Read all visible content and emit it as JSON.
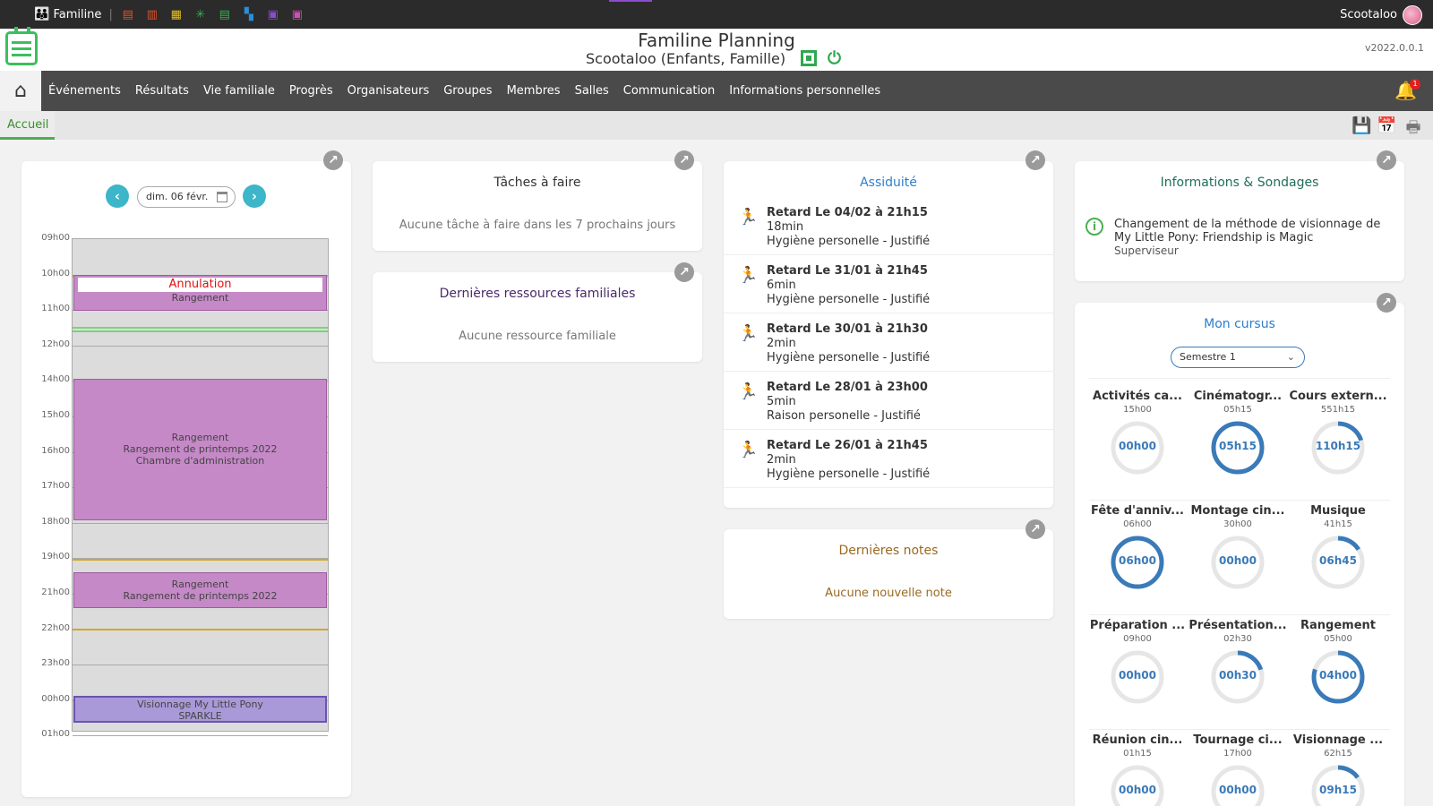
{
  "topbar": {
    "app_name": "Familine",
    "separator": "|",
    "app_icons": [
      {
        "name": "document-icon",
        "color": "#e0522a",
        "glyph": "▤"
      },
      {
        "name": "book-icon",
        "color": "#e0522a",
        "glyph": "▥"
      },
      {
        "name": "film-icon",
        "color": "#e5c020",
        "glyph": "▦"
      },
      {
        "name": "network-icon",
        "color": "#2fb24a",
        "glyph": "✳"
      },
      {
        "name": "list-icon",
        "color": "#2fb24a",
        "glyph": "▤"
      },
      {
        "name": "sitemap-icon",
        "color": "#2a8ed8",
        "glyph": "▚"
      },
      {
        "name": "upload-icon",
        "color": "#8c4bd1",
        "glyph": "▣"
      },
      {
        "name": "contact-icon",
        "color": "#d54bb5",
        "glyph": "▣"
      }
    ],
    "username": "Scootaloo"
  },
  "header": {
    "title": "Familine Planning",
    "subtitle": "Scootaloo (Enfants, Famille)",
    "version": "v2022.0.0.1"
  },
  "nav": {
    "items": [
      "Événements",
      "Résultats",
      "Vie familiale",
      "Progrès",
      "Organisateurs",
      "Groupes",
      "Membres",
      "Salles",
      "Communication",
      "Informations personnelles"
    ],
    "notification_count": "1"
  },
  "tabs": {
    "active": "Accueil"
  },
  "calendar": {
    "date": "dim. 06 févr.",
    "hours": [
      "09h00",
      "10h00",
      "11h00",
      "12h00",
      "14h00",
      "15h00",
      "16h00",
      "17h00",
      "18h00",
      "19h00",
      "21h00",
      "22h00",
      "23h00",
      "00h00",
      "01h00"
    ],
    "events": [
      {
        "status": "Annulation",
        "lines": [
          "Rangement"
        ]
      },
      {
        "lines": [
          "Rangement",
          "Rangement de printemps 2022",
          "Chambre d'administration"
        ]
      },
      {
        "lines": [
          "Rangement",
          "Rangement de printemps 2022"
        ]
      },
      {
        "lines": [
          "Visionnage My Little Pony",
          "SPARKLE"
        ]
      }
    ]
  },
  "tasks": {
    "title": "Tâches à faire",
    "empty": "Aucune tâche à faire dans les 7 prochains jours"
  },
  "resources": {
    "title": "Dernières ressources familiales",
    "empty": "Aucune ressource familiale"
  },
  "attendance": {
    "title": "Assiduité",
    "items": [
      {
        "title": "Retard Le 04/02 à 21h15",
        "duration": "18min",
        "reason": "Hygiène personelle - Justifié"
      },
      {
        "title": "Retard Le 31/01 à 21h45",
        "duration": "6min",
        "reason": "Hygiène personelle - Justifié"
      },
      {
        "title": "Retard Le 30/01 à 21h30",
        "duration": "2min",
        "reason": "Hygiène personelle - Justifié"
      },
      {
        "title": "Retard Le 28/01 à 23h00",
        "duration": "5min",
        "reason": "Raison personelle - Justifié"
      },
      {
        "title": "Retard Le 26/01 à 21h45",
        "duration": "2min",
        "reason": "Hygiène personelle - Justifié"
      }
    ]
  },
  "notes": {
    "title": "Dernières notes",
    "empty": "Aucune nouvelle note"
  },
  "info": {
    "title": "Informations & Sondages",
    "message": "Changement de la méthode de visionnage de My Little Pony: Friendship is Magic",
    "author": "Superviseur"
  },
  "cursus": {
    "title": "Mon cursus",
    "semester": "Semestre 1",
    "items": [
      {
        "name": "Activités ca...",
        "target": "15h00",
        "done": "00h00",
        "progress": 0
      },
      {
        "name": "Cinématogr...",
        "target": "05h15",
        "done": "05h15",
        "progress": 1
      },
      {
        "name": "Cours extern...",
        "target": "551h15",
        "done": "110h15",
        "progress": 0.2
      },
      {
        "name": "Fête d'anniv...",
        "target": "06h00",
        "done": "06h00",
        "progress": 1
      },
      {
        "name": "Montage cin...",
        "target": "30h00",
        "done": "00h00",
        "progress": 0
      },
      {
        "name": "Musique",
        "target": "41h15",
        "done": "06h45",
        "progress": 0.16
      },
      {
        "name": "Préparation ...",
        "target": "09h00",
        "done": "00h00",
        "progress": 0
      },
      {
        "name": "Présentation...",
        "target": "02h30",
        "done": "00h30",
        "progress": 0.2
      },
      {
        "name": "Rangement",
        "target": "05h00",
        "done": "04h00",
        "progress": 0.8
      },
      {
        "name": "Réunion cin...",
        "target": "01h15",
        "done": "00h00",
        "progress": 0
      },
      {
        "name": "Tournage ci...",
        "target": "17h00",
        "done": "00h00",
        "progress": 0
      },
      {
        "name": "Visionnage ...",
        "target": "62h15",
        "done": "09h15",
        "progress": 0.15
      }
    ]
  },
  "colors": {
    "accent_green": "#4caf50",
    "ring_blue": "#3a7ab8",
    "event_purple": "#c589c7",
    "cancel_red": "#d11111",
    "title_purple": "#4a2a6a",
    "notes_brown": "#9a6a20"
  }
}
